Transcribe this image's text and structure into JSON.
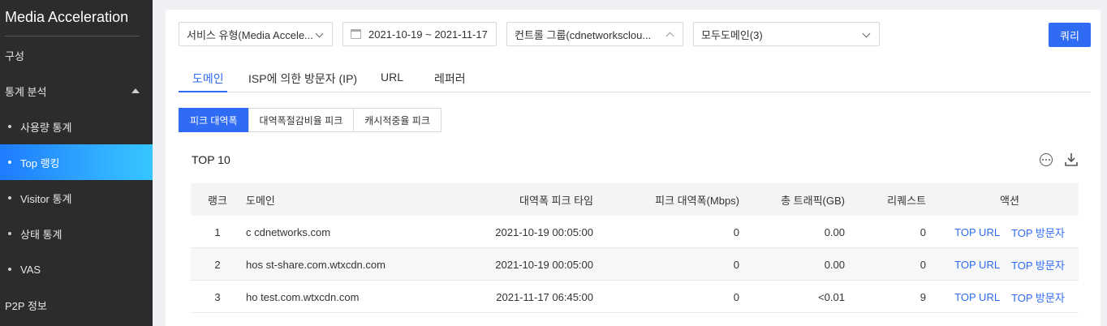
{
  "sidebar": {
    "title": "Media Acceleration",
    "items": [
      {
        "label": "구성",
        "type": "top"
      },
      {
        "label": "통계 분석",
        "type": "top",
        "expanded": true
      },
      {
        "label": "사용량 통계",
        "type": "sub"
      },
      {
        "label": "Top 랭킹",
        "type": "sub",
        "active": true
      },
      {
        "label": "Visitor 통계",
        "type": "sub"
      },
      {
        "label": "상태 통계",
        "type": "sub"
      },
      {
        "label": "VAS",
        "type": "sub"
      },
      {
        "label": "P2P 정보",
        "type": "top"
      }
    ]
  },
  "filters": {
    "service_type": "서비스 유형(Media Accele...",
    "date_range": "2021-10-19 ~ 2021-11-17",
    "control_group": "컨트롤 그룹(cdnetworksclou...",
    "domain_select": "모두도메인(3)",
    "query_label": "쿼리"
  },
  "tabs": [
    {
      "label": "도메인",
      "active": true
    },
    {
      "label": "ISP에 의한 방문자 (IP)"
    },
    {
      "label": "URL"
    },
    {
      "label": "레퍼러"
    }
  ],
  "segments": [
    {
      "label": "피크 대역폭",
      "active": true
    },
    {
      "label": "대역폭절감비율 피크"
    },
    {
      "label": "캐시적중율 피크"
    }
  ],
  "section_title": "TOP 10",
  "table": {
    "headers": {
      "rank": "랭크",
      "domain": "도메인",
      "peak_time": "대역폭 피크 타임",
      "peak_bw": "피크 대역폭(Mbps)",
      "total_traffic": "총 트래픽(GB)",
      "requests": "리퀘스트",
      "action": "액션"
    },
    "rows": [
      {
        "rank": "1",
        "domain": "c        cdnetworks.com",
        "peak_time": "2021-10-19 00:05:00",
        "peak_bw": "0",
        "total_traffic": "0.00",
        "requests": "0",
        "link1": "TOP URL",
        "link2": "TOP 방문자"
      },
      {
        "rank": "2",
        "domain": "hos      st-share.com.wtxcdn.com",
        "peak_time": "2021-10-19 00:05:00",
        "peak_bw": "0",
        "total_traffic": "0.00",
        "requests": "0",
        "link1": "TOP URL",
        "link2": "TOP 방문자"
      },
      {
        "rank": "3",
        "domain": "ho      test.com.wtxcdn.com",
        "peak_time": "2021-11-17 06:45:00",
        "peak_bw": "0",
        "total_traffic": "<0.01",
        "requests": "9",
        "link1": "TOP URL",
        "link2": "TOP 방문자"
      }
    ]
  }
}
